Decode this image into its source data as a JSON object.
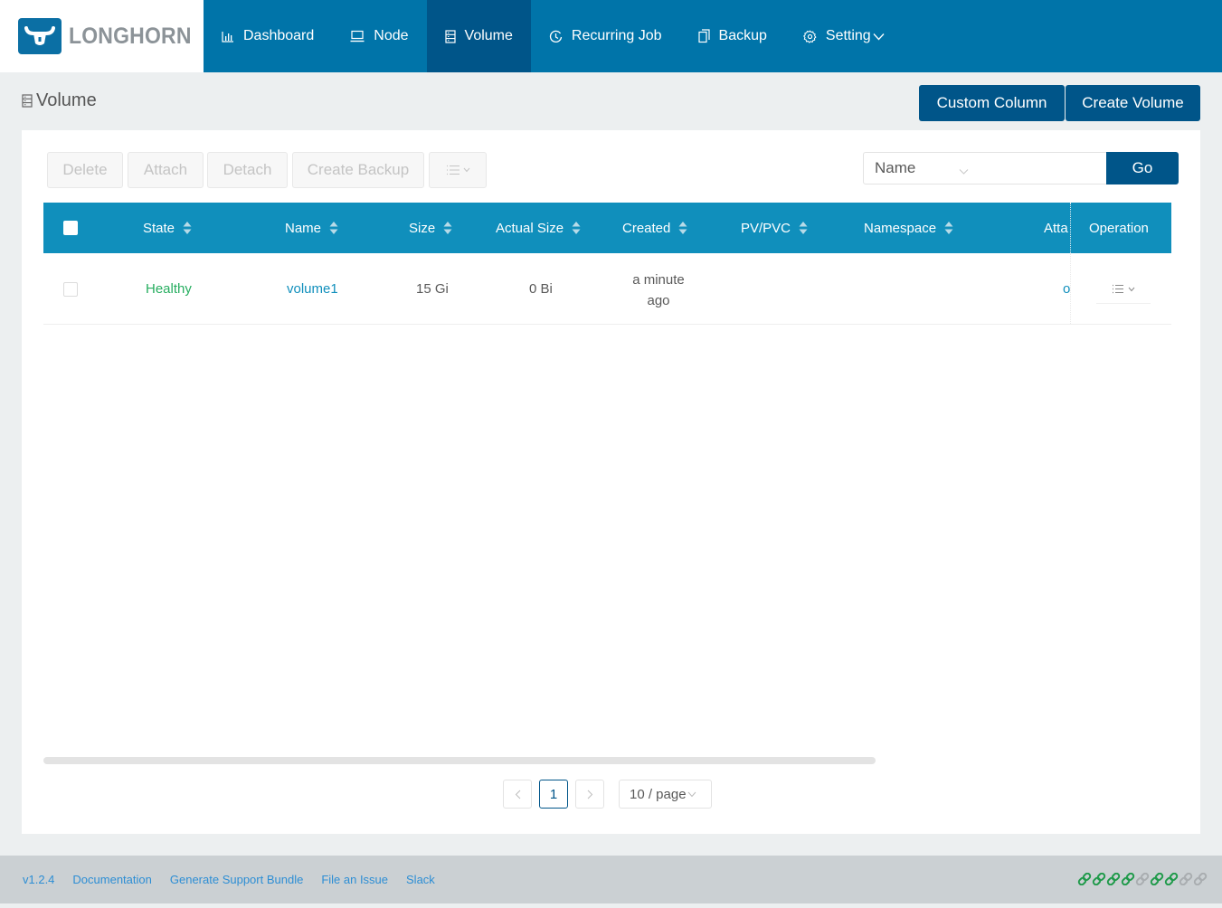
{
  "app": {
    "logo_text": "LONGHORN",
    "brand_color": "#0074a9",
    "active_nav_color": "#005589"
  },
  "nav": {
    "items": [
      {
        "label": "Dashboard",
        "icon": "bar-chart-icon"
      },
      {
        "label": "Node",
        "icon": "laptop-icon"
      },
      {
        "label": "Volume",
        "icon": "database-icon",
        "active": true
      },
      {
        "label": "Recurring Job",
        "icon": "clock-icon"
      },
      {
        "label": "Backup",
        "icon": "copy-icon"
      },
      {
        "label": "Setting",
        "icon": "gear-icon",
        "has_dropdown": true
      }
    ]
  },
  "page": {
    "title": "Volume",
    "custom_column_label": "Custom Column",
    "create_volume_label": "Create Volume"
  },
  "toolbar": {
    "delete_label": "Delete",
    "attach_label": "Attach",
    "detach_label": "Detach",
    "create_backup_label": "Create Backup",
    "filter_field": "Name",
    "filter_value": "",
    "go_label": "Go"
  },
  "table": {
    "columns": [
      "State",
      "Name",
      "Size",
      "Actual Size",
      "Created",
      "PV/PVC",
      "Namespace",
      "Atta",
      "Operation"
    ],
    "rows": [
      {
        "state": "Healthy",
        "name": "volume1",
        "size": "15 Gi",
        "actual_size": "0 Bi",
        "created_line1": "a minute",
        "created_line2": "ago",
        "pv_pvc": "",
        "namespace": "",
        "attached": "o"
      }
    ],
    "state_color": "#27ae60",
    "link_color": "#108fbc"
  },
  "pagination": {
    "prev": "<",
    "current_page": "1",
    "next": ">",
    "page_size": "10 / page"
  },
  "footer": {
    "version": "v1.2.4",
    "links": [
      "Documentation",
      "Generate Support Bundle",
      "File an Issue",
      "Slack"
    ],
    "connection_status": [
      true,
      true,
      true,
      true,
      false,
      true,
      true,
      false,
      false
    ]
  }
}
